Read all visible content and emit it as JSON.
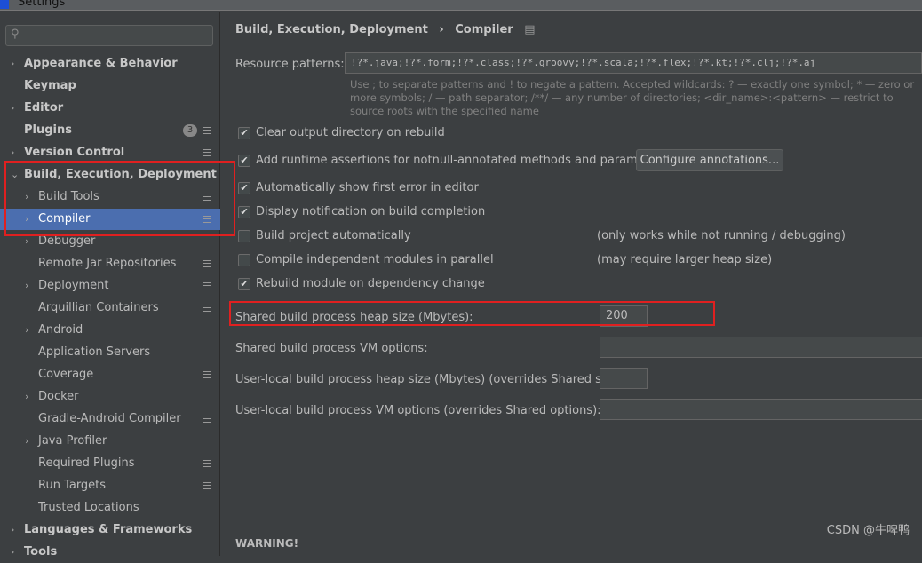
{
  "window": {
    "title": "Settings"
  },
  "sidebar": {
    "search_placeholder": "",
    "items": [
      {
        "label": "Appearance & Behavior",
        "level": 0,
        "expandable": true
      },
      {
        "label": "Keymap",
        "level": 0,
        "expandable": false
      },
      {
        "label": "Editor",
        "level": 0,
        "expandable": true
      },
      {
        "label": "Plugins",
        "level": 0,
        "expandable": false,
        "badge": "3",
        "marker": true
      },
      {
        "label": "Version Control",
        "level": 0,
        "expandable": true,
        "marker": true
      },
      {
        "label": "Build, Execution, Deployment",
        "level": 0,
        "expandable": true,
        "expanded": true
      },
      {
        "label": "Build Tools",
        "level": 1,
        "expandable": true,
        "marker": true
      },
      {
        "label": "Compiler",
        "level": 1,
        "expandable": true,
        "marker": true,
        "selected": true
      },
      {
        "label": "Debugger",
        "level": 1,
        "expandable": true
      },
      {
        "label": "Remote Jar Repositories",
        "level": 1,
        "expandable": false,
        "marker": true
      },
      {
        "label": "Deployment",
        "level": 1,
        "expandable": true,
        "marker": true
      },
      {
        "label": "Arquillian Containers",
        "level": 1,
        "expandable": false,
        "marker": true
      },
      {
        "label": "Android",
        "level": 1,
        "expandable": true
      },
      {
        "label": "Application Servers",
        "level": 1,
        "expandable": false
      },
      {
        "label": "Coverage",
        "level": 1,
        "expandable": false,
        "marker": true
      },
      {
        "label": "Docker",
        "level": 1,
        "expandable": true
      },
      {
        "label": "Gradle-Android Compiler",
        "level": 1,
        "expandable": false,
        "marker": true
      },
      {
        "label": "Java Profiler",
        "level": 1,
        "expandable": true
      },
      {
        "label": "Required Plugins",
        "level": 1,
        "expandable": false,
        "marker": true
      },
      {
        "label": "Run Targets",
        "level": 1,
        "expandable": false,
        "marker": true
      },
      {
        "label": "Trusted Locations",
        "level": 1,
        "expandable": false
      },
      {
        "label": "Languages & Frameworks",
        "level": 0,
        "expandable": true
      },
      {
        "label": "Tools",
        "level": 0,
        "expandable": true
      }
    ]
  },
  "main": {
    "breadcrumb": [
      "Build, Execution, Deployment",
      "›",
      "Compiler"
    ],
    "resource_patterns_label": "Resource patterns:",
    "resource_patterns_value": "!?*.java;!?*.form;!?*.class;!?*.groovy;!?*.scala;!?*.flex;!?*.kt;!?*.clj;!?*.aj",
    "hint": "Use ; to separate patterns and ! to negate a pattern. Accepted wildcards: ? — exactly one symbol; * — zero or more symbols; / — path separator; /**/ — any number of directories; <dir_name>:<pattern> — restrict to source roots with the specified name",
    "checkboxes": [
      {
        "label": "Clear output directory on rebuild",
        "checked": true
      },
      {
        "label": "Add runtime assertions for notnull-annotated methods and parameters",
        "checked": true
      },
      {
        "label": "Automatically show first error in editor",
        "checked": true
      },
      {
        "label": "Display notification on build completion",
        "checked": true
      },
      {
        "label": "Build project automatically",
        "checked": false,
        "note": "(only works while not running / debugging)"
      },
      {
        "label": "Compile independent modules in parallel",
        "checked": false,
        "note": "(may require larger heap size)"
      },
      {
        "label": "Rebuild module on dependency change",
        "checked": true
      }
    ],
    "configure_button": "Configure annotations...",
    "fields": [
      {
        "label": "Shared build process heap size (Mbytes):",
        "value": "200"
      },
      {
        "label": "Shared build process VM options:",
        "value": ""
      },
      {
        "label": "User-local build process heap size (Mbytes) (overrides Shared size):",
        "value": ""
      },
      {
        "label": "User-local build process VM options (overrides Shared options):",
        "value": ""
      }
    ],
    "warning": "WARNING!"
  },
  "watermark": "CSDN @牛啤鸭",
  "colors": {
    "selection": "#4b6eaf",
    "highlight": "#e02020"
  }
}
